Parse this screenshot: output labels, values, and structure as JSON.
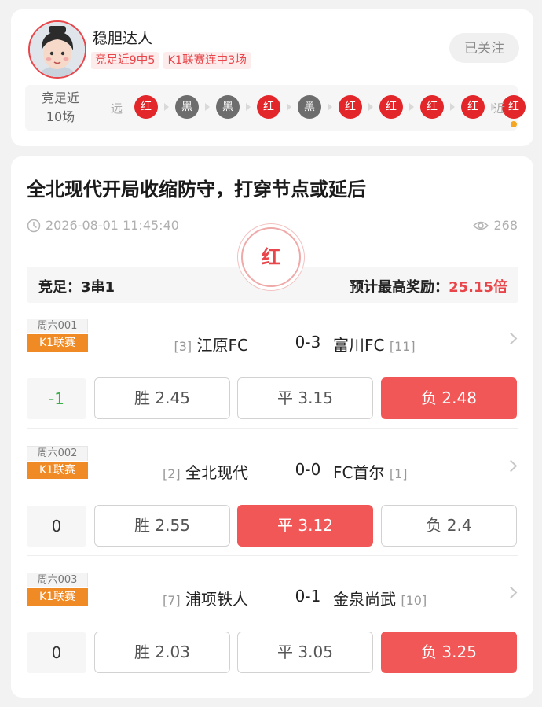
{
  "profile": {
    "username": "稳胆达人",
    "tags": [
      "竞足近9中5",
      "K1联赛连中3场"
    ],
    "follow_label": "已关注",
    "form_label": "竞足近10场",
    "far_label": "远",
    "near_label": "近",
    "results": [
      "红",
      "黑",
      "黑",
      "红",
      "黑",
      "红",
      "红",
      "红",
      "红",
      "红"
    ]
  },
  "article": {
    "title": "全北现代开局收缩防守，打穿节点或延后",
    "time": "2026-08-01 11:45:40",
    "views": "268",
    "stamp": "红",
    "summary_left": "竞足：3串1",
    "summary_right_label": "预计最高奖励：",
    "summary_right_value": "25.15倍"
  },
  "matches": [
    {
      "no": "周六001",
      "league": "K1联赛",
      "home_rank": "[3]",
      "home": "江原FC",
      "score": "0-3",
      "away": "富川FC",
      "away_rank": "[11]",
      "handicap": "-1",
      "win": "胜 2.45",
      "draw": "平 3.15",
      "lose": "负 2.48",
      "selected": "lose"
    },
    {
      "no": "周六002",
      "league": "K1联赛",
      "home_rank": "[2]",
      "home": "全北现代",
      "score": "0-0",
      "away": "FC首尔",
      "away_rank": "[1]",
      "handicap": "0",
      "win": "胜 2.55",
      "draw": "平 3.12",
      "lose": "负 2.4",
      "selected": "draw"
    },
    {
      "no": "周六003",
      "league": "K1联赛",
      "home_rank": "[7]",
      "home": "浦项铁人",
      "score": "0-1",
      "away": "金泉尚武",
      "away_rank": "[10]",
      "handicap": "0",
      "win": "胜 2.03",
      "draw": "平 3.05",
      "lose": "负 3.25",
      "selected": "lose"
    }
  ],
  "colors": {
    "accent_red": "#e8464a",
    "selected_odd": "#f25757",
    "league_badge": "#f08a24",
    "positive_handicap": "#3bae49",
    "result_black": "#6d6d6d"
  },
  "icons": [
    "avatar",
    "clock-icon",
    "eye-icon",
    "chevron-right-icon",
    "result-arrow-icon"
  ]
}
